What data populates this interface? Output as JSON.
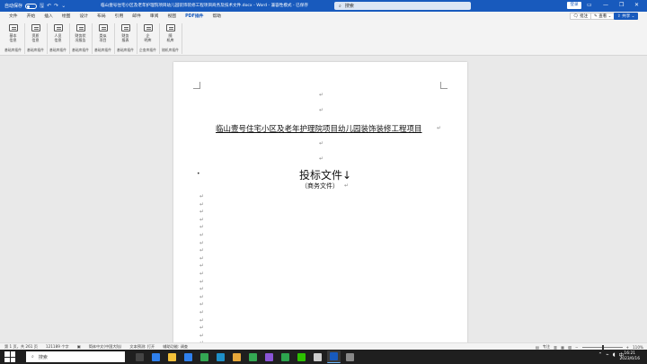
{
  "titlebar": {
    "autosave_label": "自动保存",
    "toggle_state": "关",
    "document_title": "临山壹号住宅小区及老年护理院项目幼儿园装饰装修工程项目商务及技术文件.docx - Word - 兼容性模式 - 已保存",
    "search_placeholder": "搜索",
    "login_label": "登录",
    "minimize_icon": "—",
    "restore_icon": "❐",
    "close_icon": "✕"
  },
  "menu": {
    "items": [
      "文件",
      "开始",
      "插入",
      "绘图",
      "设计",
      "布局",
      "引用",
      "邮件",
      "审阅",
      "视图",
      "PDF插件",
      "帮助"
    ],
    "active_index": 10,
    "comment_label": "批注",
    "edit_label": "查看",
    "share_label": "共享"
  },
  "ribbon": {
    "groups": [
      {
        "button": "基本\n信息",
        "group": "基础库插件"
      },
      {
        "button": "资质\n信息",
        "group": "基础库插件"
      },
      {
        "button": "人员\n信息",
        "group": "基础库插件"
      },
      {
        "button": "财务状\n况报告",
        "group": "基础库插件"
      },
      {
        "button": "类似\n项目",
        "group": "基础库插件"
      },
      {
        "button": "财务\n报表",
        "group": "基础库插件"
      },
      {
        "button": "企\n明库",
        "group": "企查库插件"
      },
      {
        "button": "随\n机库",
        "group": "随机库插件"
      }
    ]
  },
  "document": {
    "project_title": "临山壹号住宅小区及老年护理院项目幼儿园装饰装修工程项目",
    "main_title": "投标文件↓",
    "subtitle": "（商务文件）",
    "paragraph_mark": "↵"
  },
  "statusbar": {
    "page": "第 1 页，共 261 页",
    "words": "121189 个字",
    "language": "简体中文(中国大陆)",
    "prediction": "文本预测: 打开",
    "accessibility": "辅助功能: 调查",
    "focus": "专注",
    "zoom": "110%"
  },
  "taskbar": {
    "search_label": "搜索",
    "time": "16:21",
    "date": "2023/6/16",
    "apps": [
      {
        "name": "task-view",
        "color": "#444444"
      },
      {
        "name": "vscode",
        "color": "#2f80ed"
      },
      {
        "name": "file-explorer",
        "color": "#f3c13a"
      },
      {
        "name": "store",
        "color": "#2f80ed"
      },
      {
        "name": "chrome",
        "color": "#34a853"
      },
      {
        "name": "edge",
        "color": "#1e90c8"
      },
      {
        "name": "files",
        "color": "#e8a93a"
      },
      {
        "name": "chrome2",
        "color": "#34a853"
      },
      {
        "name": "visual-studio",
        "color": "#8a55d6"
      },
      {
        "name": "app-green",
        "color": "#2da44e"
      },
      {
        "name": "wechat",
        "color": "#2dc100"
      },
      {
        "name": "app-grey",
        "color": "#cccccc"
      },
      {
        "name": "word",
        "color": "#185abd"
      },
      {
        "name": "tool",
        "color": "#888888"
      }
    ]
  },
  "colors": {
    "accent": "#185abd",
    "taskbar": "#1f1f1f"
  }
}
